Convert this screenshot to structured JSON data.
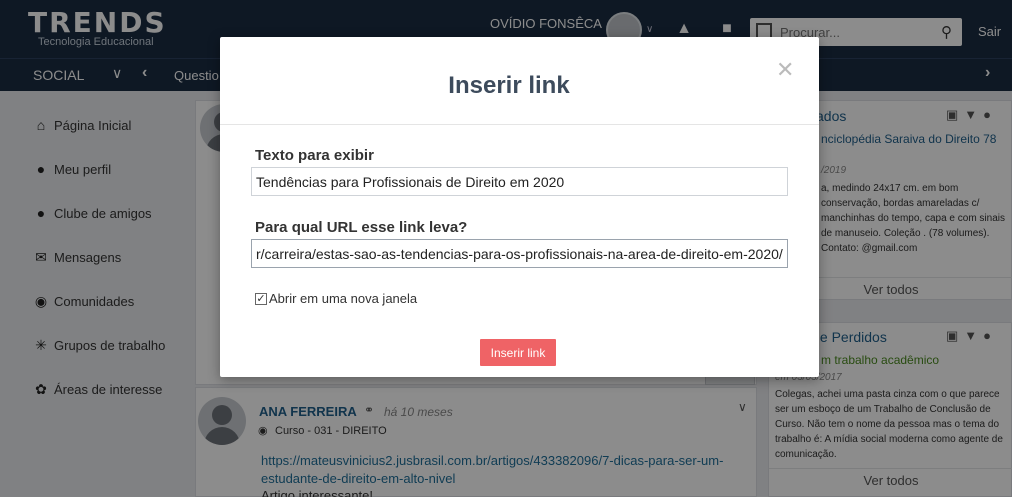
{
  "header": {
    "logo_main": "TRENDS",
    "logo_top": "ecno",
    "logo_sub": "Tecnologia Educacional",
    "user_name": "OVÍDIO FONSÊCA",
    "search_placeholder": "Procurar...",
    "logout_label": "Sair"
  },
  "nav": {
    "section": "SOCIAL",
    "crumb": "Questio"
  },
  "sidebar": {
    "items": [
      {
        "label": "Página Inicial",
        "icon": "home-icon"
      },
      {
        "label": "Meu perfil",
        "icon": "user-icon"
      },
      {
        "label": "Clube de amigos",
        "icon": "users-icon"
      },
      {
        "label": "Mensagens",
        "icon": "envelope-icon"
      },
      {
        "label": "Comunidades",
        "icon": "comments-icon"
      },
      {
        "label": "Grupos de trabalho",
        "icon": "network-icon"
      },
      {
        "label": "Áreas de interesse",
        "icon": "interest-icon"
      }
    ]
  },
  "feed": {
    "post": {
      "author": "ANA FERREIRA",
      "time": "há 10 meses",
      "community": "Curso - 031 - DIREITO",
      "url": "https://mateusvinicius2.jusbrasil.com.br/artigos/433382096/7-dicas-para-ser-um-estudante-de-direito-em-alto-nivel",
      "text": "Artigo interessante!"
    }
  },
  "right": {
    "card1": {
      "title": "cados",
      "link": "nciclopédia Saraiva do Direito 78",
      "date": "/2019",
      "body": "a, medindo 24x17 cm. em bom conservação, bordas amareladas c/ manchinhas do tempo, capa e com sinais de manuseio. Coleção . (78 volumes). Contato: @gmail.com",
      "see_all": "Ver todos"
    },
    "card2": {
      "title": "s e Perdidos",
      "sub": "m trabalho acadêmico",
      "date": "em 03/03/2017",
      "body": "Colegas, achei uma pasta cinza com o que parece ser um esboço de um Trabalho de Conclusão de Curso. Não tem o nome da pessoa mas o tema do trabalho é: A mídia social moderna como agente de comunicação.",
      "see_all": "Ver todos"
    }
  },
  "modal": {
    "title": "Inserir link",
    "display_label": "Texto para exibir",
    "display_value": "Tendências para Profissionais de Direito em 2020",
    "url_label": "Para qual URL esse link leva?",
    "url_value": "r/carreira/estas-sao-as-tendencias-para-os-profissionais-na-area-de-direito-em-2020/",
    "new_window_label": "Abrir em uma nova janela",
    "new_window_checked": true,
    "submit_label": "Inserir link",
    "accent_color": "#ef6366"
  }
}
